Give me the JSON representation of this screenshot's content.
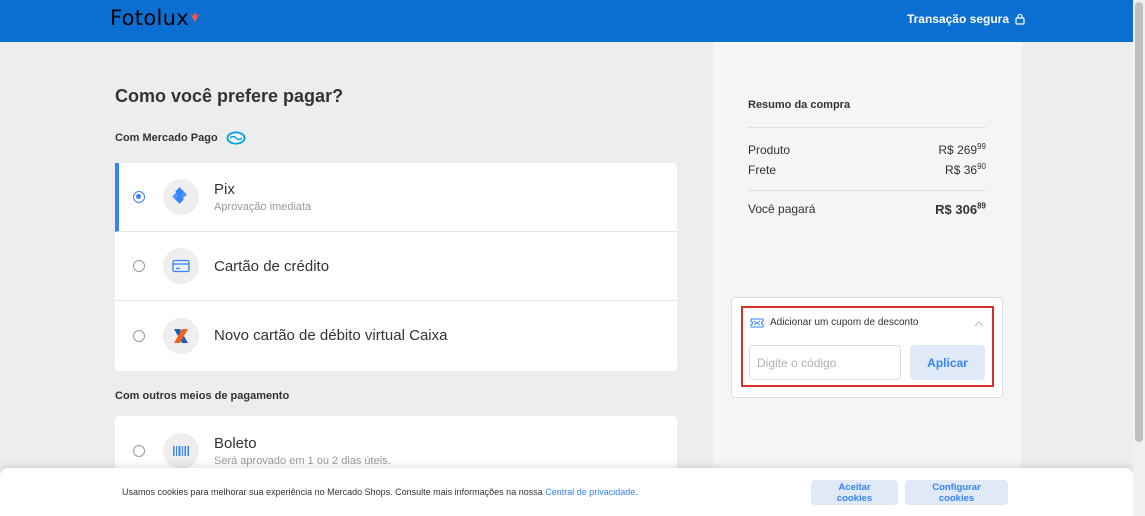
{
  "header": {
    "logo": "Fotolux",
    "secure_label": "Transação segura",
    "secure_icon": "lock-icon",
    "background": "#0a6fd1"
  },
  "main": {
    "title": "Como você prefere pagar?",
    "mp_section_label": "Com Mercado Pago",
    "mp_options": [
      {
        "title": "Pix",
        "subtitle": "Aprovação imediata",
        "icon": "pix-icon",
        "selected": true
      },
      {
        "title": "Cartão de crédito",
        "icon": "credit-card-icon",
        "selected": false
      },
      {
        "title": "Novo cartão de débito virtual Caixa",
        "icon": "caixa-logo-icon",
        "selected": false
      }
    ],
    "other_section_label": "Com outros meios de pagamento",
    "other_options": [
      {
        "title": "Boleto",
        "subtitle": "Será aprovado em 1 ou 2 dias úteis.",
        "icon": "barcode-icon",
        "selected": false
      }
    ]
  },
  "summary": {
    "title": "Resumo da compra",
    "rows": [
      {
        "label": "Produto",
        "currency": "R$",
        "int": "269",
        "cents": "99"
      },
      {
        "label": "Frete",
        "currency": "R$",
        "int": "36",
        "cents": "90"
      }
    ],
    "total": {
      "label": "Você pagará",
      "currency": "R$",
      "int": "306",
      "cents": "89"
    }
  },
  "coupon": {
    "label": "Adicionar um cupom de desconto",
    "icon": "ticket-icon",
    "placeholder": "Digite o código",
    "value": "",
    "apply_label": "Aplicar"
  },
  "cookies": {
    "text": "Usamos cookies para melhorar sua experiência no Mercado Shops. Consulte mais informações na nossa",
    "link": "Central de privacidade.",
    "accept_label": "Aceitar cookies",
    "config_label": "Configurar cookies"
  },
  "colors": {
    "accent": "#3483fa",
    "highlight": "#d9302c"
  }
}
